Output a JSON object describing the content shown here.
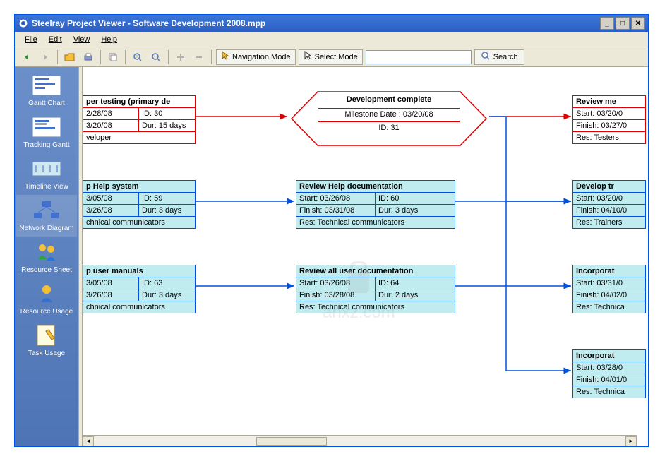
{
  "window_title": "Steelray Project Viewer - Software Development 2008.mpp",
  "menu": {
    "file": "File",
    "edit": "Edit",
    "view": "View",
    "help": "Help"
  },
  "toolbar": {
    "nav_mode": "Navigation Mode",
    "select_mode": "Select Mode",
    "search_label": "Search",
    "search_placeholder": ""
  },
  "sidebar": {
    "items": [
      {
        "label": "Gantt Chart"
      },
      {
        "label": "Tracking Gantt"
      },
      {
        "label": "Timeline View"
      },
      {
        "label": "Network Diagram"
      },
      {
        "label": "Resource Sheet"
      },
      {
        "label": "Resource Usage"
      },
      {
        "label": "Task Usage"
      }
    ]
  },
  "nodes": {
    "n1": {
      "title": "per testing (primary de",
      "start": "2/28/08",
      "id": "ID:  30",
      "finish": "3/20/08",
      "dur": "Dur: 15 days",
      "res": "veloper"
    },
    "milestone": {
      "title": "Development complete",
      "date": "Milestone Date : 03/20/08",
      "id": "ID: 31"
    },
    "n2": {
      "title": "Review me",
      "start": "Start:  03/20/0",
      "finish": "Finish: 03/27/0",
      "res": "Res: Testers"
    },
    "n3": {
      "title": "p Help system",
      "start": "3/05/08",
      "id": "ID:  59",
      "finish": "3/26/08",
      "dur": "Dur: 3 days",
      "res": "chnical communicators"
    },
    "n4": {
      "title": "Review Help documentation",
      "start": "Start:  03/26/08",
      "id": "ID:  60",
      "finish": "Finish: 03/31/08",
      "dur": "Dur: 3 days",
      "res": "Res: Technical communicators"
    },
    "n5": {
      "title": "Develop tr",
      "start": "Start:  03/20/0",
      "finish": "Finish: 04/10/0",
      "res": "Res: Trainers"
    },
    "n6": {
      "title": "p user manuals",
      "start": "3/05/08",
      "id": "ID:  63",
      "finish": "3/26/08",
      "dur": "Dur: 3 days",
      "res": "chnical communicators"
    },
    "n7": {
      "title": "Review all user documentation",
      "start": "Start:  03/26/08",
      "id": "ID:  64",
      "finish": "Finish: 03/28/08",
      "dur": "Dur: 2 days",
      "res": "Res: Technical communicators"
    },
    "n8": {
      "title": "Incorporat",
      "start": "Start:  03/31/0",
      "finish": "Finish: 04/02/0",
      "res": "Res: Technica"
    },
    "n9": {
      "title": "Incorporat",
      "start": "Start:  03/28/0",
      "finish": "Finish: 04/01/0",
      "res": "Res: Technica"
    }
  },
  "watermark": "anxz.com"
}
